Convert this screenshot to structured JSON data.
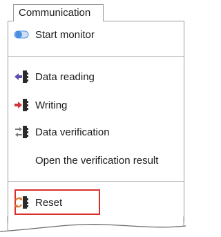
{
  "tab": {
    "label": "Communication"
  },
  "menu": {
    "start_monitor": "Start monitor",
    "data_reading": "Data reading",
    "writing": "Writing",
    "data_verification": "Data verification",
    "open_verification_result": "Open the verification result",
    "reset": "Reset"
  },
  "icons": {
    "start_monitor": "toggle-switch-icon",
    "data_reading": "read-arrow-icon",
    "writing": "write-arrow-icon",
    "data_verification": "verify-icon",
    "reset": "reset-icon"
  },
  "colors": {
    "highlight_border": "#d9302a",
    "toggle": "#4a90e2",
    "read_arrow": "#5b4fb0",
    "write_arrow": "#d0343f",
    "reset_icon": "#e0782b"
  }
}
